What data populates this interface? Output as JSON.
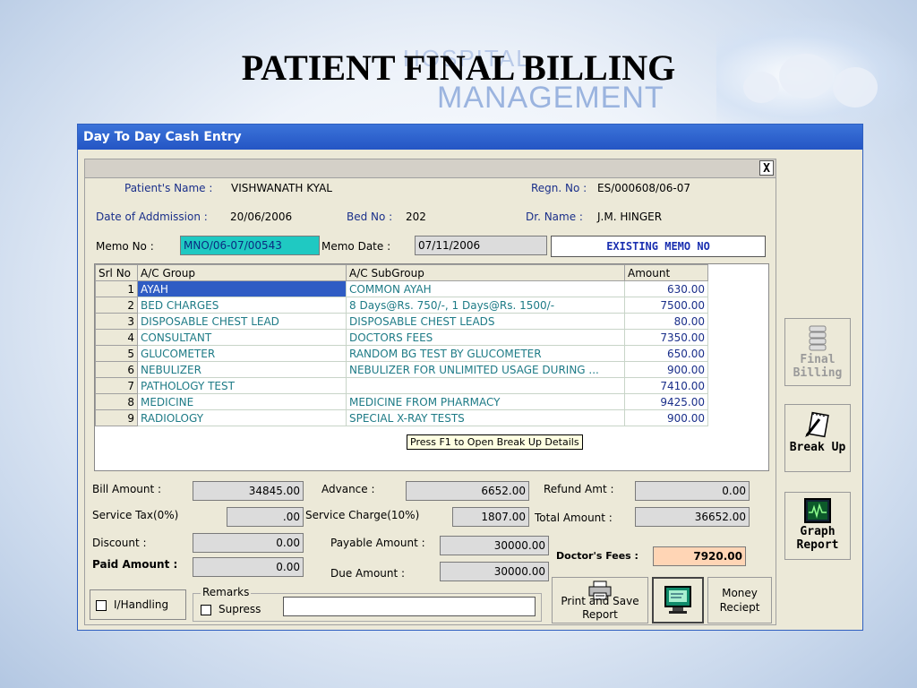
{
  "slide": {
    "title": "PATIENT FINAL BILLING",
    "watermark_line1": "HOSPITAL",
    "watermark_line2": "MANAGEMENT"
  },
  "window": {
    "title": "Day To Day Cash Entry",
    "close_label": "X"
  },
  "patient": {
    "name_label": "Patient's Name :",
    "name": "VISHWANATH KYAL",
    "regn_label": "Regn. No :",
    "regn": "ES/000608/06-07",
    "admission_label": "Date of Addmission :",
    "admission": "20/06/2006",
    "bed_label": "Bed No :",
    "bed": "202",
    "doctor_label": "Dr. Name :",
    "doctor": "J.M. HINGER",
    "memo_label": "Memo No :",
    "memo": "MNO/06-07/00543",
    "memo_date_label": "Memo Date :",
    "memo_date": "07/11/2006",
    "memo_status": "EXISTING MEMO NO"
  },
  "grid": {
    "columns": [
      "Srl No",
      "A/C Group",
      "A/C SubGroup",
      "Amount"
    ],
    "rows": [
      {
        "srl": "1",
        "group": "AYAH",
        "subgroup": "COMMON AYAH",
        "amount": "630.00"
      },
      {
        "srl": "2",
        "group": "BED CHARGES",
        "subgroup": "8 Days@Rs. 750/-, 1 Days@Rs. 1500/-",
        "amount": "7500.00"
      },
      {
        "srl": "3",
        "group": "DISPOSABLE CHEST LEAD",
        "subgroup": "DISPOSABLE CHEST LEADS",
        "amount": "80.00"
      },
      {
        "srl": "4",
        "group": "CONSULTANT",
        "subgroup": "DOCTORS FEES",
        "amount": "7350.00"
      },
      {
        "srl": "5",
        "group": "GLUCOMETER",
        "subgroup": "RANDOM BG TEST BY GLUCOMETER",
        "amount": "650.00"
      },
      {
        "srl": "6",
        "group": "NEBULIZER",
        "subgroup": "NEBULIZER FOR UNLIMITED USAGE DURING ...",
        "amount": "900.00"
      },
      {
        "srl": "7",
        "group": "PATHOLOGY TEST",
        "subgroup": "",
        "amount": "7410.00"
      },
      {
        "srl": "8",
        "group": "MEDICINE",
        "subgroup": "MEDICINE FROM PHARMACY",
        "amount": "9425.00"
      },
      {
        "srl": "9",
        "group": "RADIOLOGY",
        "subgroup": "SPECIAL X-RAY TESTS",
        "amount": "900.00"
      }
    ],
    "tooltip": "Press F1 to Open Break Up Details"
  },
  "summary": {
    "bill_amount_label": "Bill Amount :",
    "bill_amount": "34845.00",
    "advance_label": "Advance :",
    "advance": "6652.00",
    "refund_label": "Refund Amt :",
    "refund": "0.00",
    "service_tax_label": "Service Tax(0%)",
    "service_tax": ".00",
    "service_charge_label": "Service Charge(10%)",
    "service_charge": "1807.00",
    "total_label": "Total Amount :",
    "total": "36652.00",
    "discount_label": "Discount :",
    "discount": "0.00",
    "payable_label": "Payable Amount :",
    "payable": "30000.00",
    "doctor_fees_label": "Doctor's Fees :",
    "doctor_fees": "7920.00",
    "paid_label": "Paid Amount :",
    "paid": "0.00",
    "due_label": "Due Amount :",
    "due": "30000.00"
  },
  "bottom": {
    "ihandling_label": "I/Handling",
    "remarks_legend": "Remarks",
    "supress_label": "Supress",
    "print_save_label": "Print and Save Report",
    "money_receipt_label": "Money Reciept"
  },
  "side_buttons": {
    "final_billing": "Final Billing",
    "break_up": "Break Up",
    "graph_report": "Graph Report"
  },
  "colors": {
    "titlebar": "#2455c4",
    "memo_highlight": "#1fc9c2",
    "selection": "#2f5cc4",
    "doctor_fees_bg": "#ffd5b5"
  }
}
